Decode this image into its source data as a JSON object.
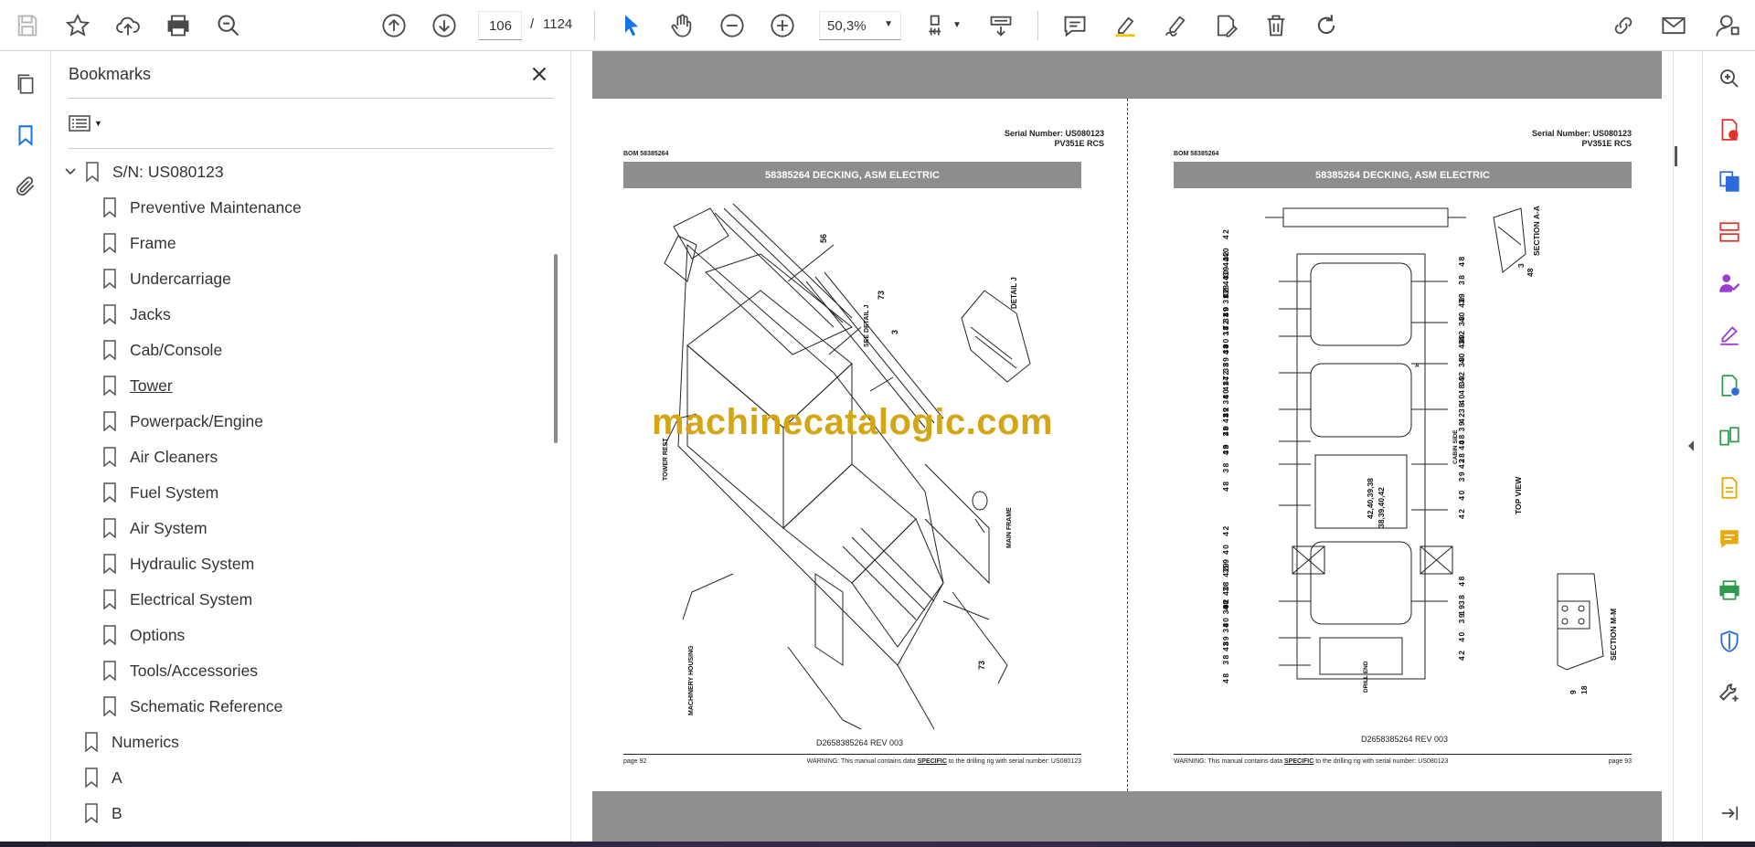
{
  "toolbar": {
    "page_current": "106",
    "page_sep": "/",
    "page_total": "1124",
    "zoom": "50,3%"
  },
  "bookmarks": {
    "title": "Bookmarks",
    "root": "S/N: US080123",
    "children": [
      "Preventive Maintenance",
      "Frame",
      "Undercarriage",
      "Jacks",
      "Cab/Console",
      "Tower",
      "Powerpack/Engine",
      "Air Cleaners",
      "Fuel System",
      "Air System",
      "Hydraulic System",
      "Electrical System",
      "Options",
      "Tools/Accessories",
      "Schematic Reference"
    ],
    "top_level": [
      "Numerics",
      "A",
      "B"
    ]
  },
  "left_page": {
    "serial": "Serial Number: US080123",
    "model": "PV351E RCS",
    "bom": "BOM 58385264",
    "band_title": "58385264 DECKING, ASM ELECTRIC",
    "labels": [
      "56",
      "SEE DETAIL J",
      "73",
      "3",
      "DETAIL J",
      "TOWER REST",
      "MACHINERY HOUSING",
      "MAIN FRAME",
      "73"
    ],
    "dwg_no": "D2658385264 REV 003",
    "page_no": "page 92",
    "warning_pre": "WARNING:  This manual contains data ",
    "warning_em": "SPECIFIC",
    "warning_post": " to the drilling rig with serial number: US080123"
  },
  "right_page": {
    "serial": "Serial Number: US080123",
    "model": "PV351E RCS",
    "bom": "BOM 58385264",
    "band_title": "58385264 DECKING, ASM ELECTRIC",
    "section_aa": "SECTION A-A",
    "section_mm": "SECTION M-M",
    "top_view": "TOP VIEW",
    "cabin_side": "CABIN SIDE",
    "drill_end": "DRILL END",
    "label_a": "A",
    "callout_up": "42,40,39,38",
    "callout_down": "38,39,40,42",
    "left_rows": [
      "38 39 40 42",
      "38 39 40 42",
      "48 38 39 17 40 42",
      "48 38 39 17 40 42",
      "48 38 17 39 40 42",
      "48 38 39 40 42",
      "48 38 39 40 42",
      "19",
      "48 38 39 40 42",
      "48 38 39 40 42",
      "48 38 39 40 42"
    ],
    "right_rows": [
      "42 40 39 38 48",
      "42 40 39 38 48",
      "42 40 39 38 48",
      "42 40 39 38 48",
      "42 40 39 38 48",
      "19",
      "42 40 39 38 48"
    ],
    "mm_labels": [
      "9",
      "18"
    ],
    "aa_labels": [
      "3",
      "48"
    ],
    "dwg_no": "D2658385264 REV 003",
    "page_no": "page 93",
    "warning_pre": "WARNING:  This manual contains data ",
    "warning_em": "SPECIFIC",
    "warning_post": " to the drilling rig with serial number: US080123"
  },
  "watermark": "machinecatalogic.com"
}
